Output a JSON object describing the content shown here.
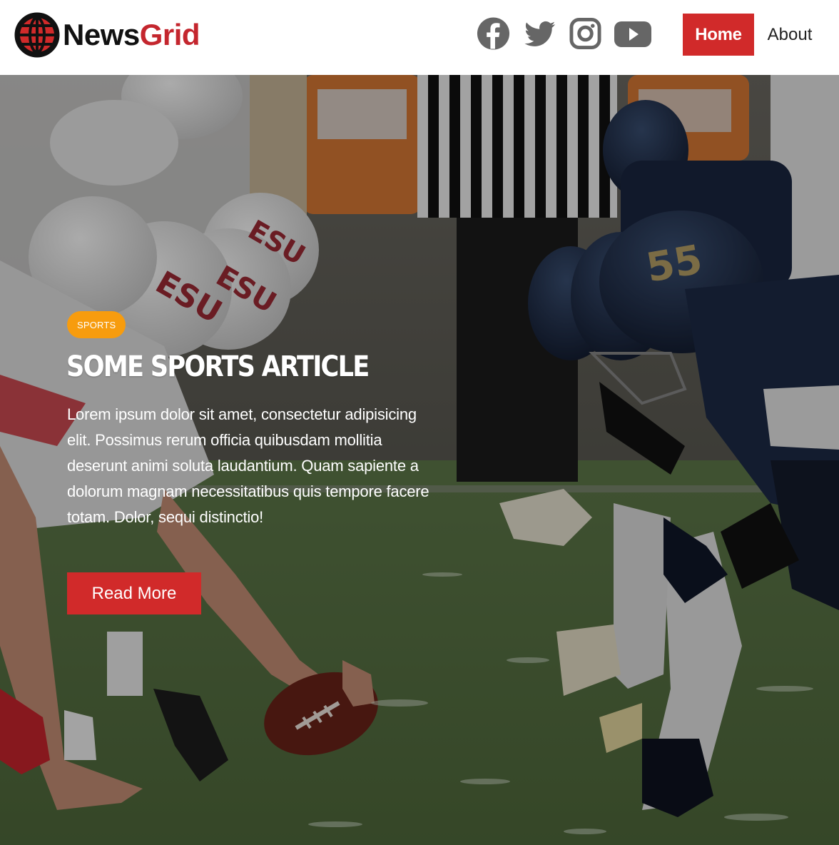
{
  "brand": {
    "name_part1": "News",
    "name_part2": "Grid",
    "primary_color": "#d12a2a",
    "logo_icon": "globe-icon"
  },
  "social_icons": [
    "facebook-icon",
    "twitter-icon",
    "instagram-icon",
    "youtube-icon"
  ],
  "nav": {
    "home_label": "Home",
    "about_label": "About"
  },
  "hero": {
    "category": "SPORTS",
    "category_color": "#f79c0e",
    "title": "SOME SPORTS ARTICLE",
    "body": "Lorem ipsum dolor sit amet, consectetur adipisicing elit. Possimus rerum officia quibusdam mollitia deserunt animi soluta laudantium. Quam sapiente a dolorum magnam necessitatibus quis tempore facere totam. Dolor, sequi distinctio!",
    "button_label": "Read More"
  }
}
